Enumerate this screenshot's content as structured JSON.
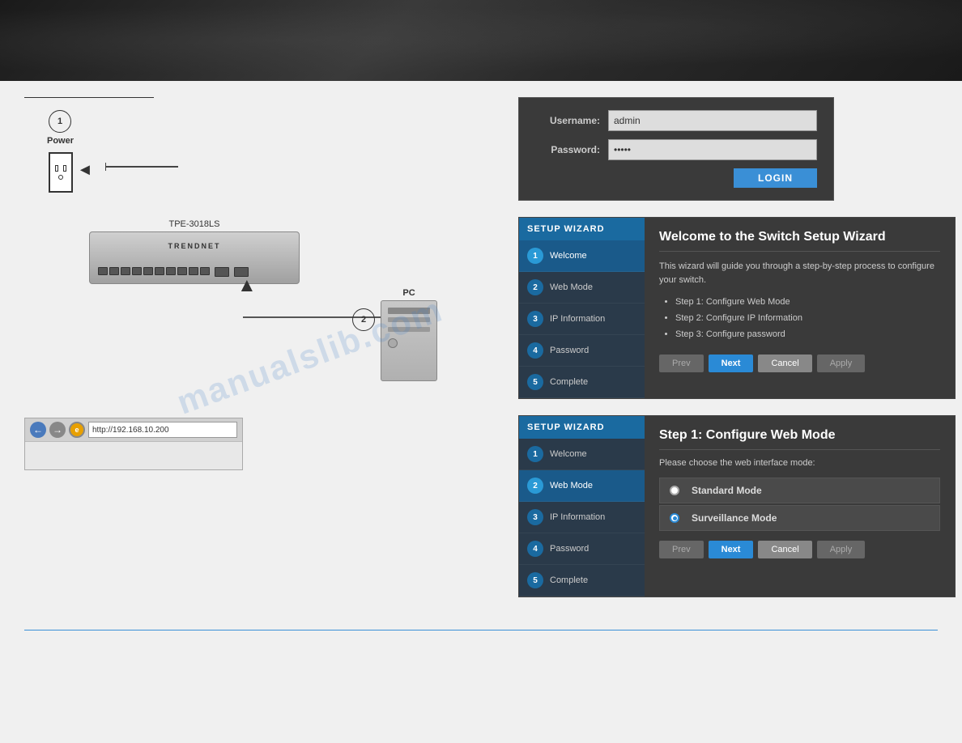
{
  "header": {
    "banner_alt": "TRENDnet header banner"
  },
  "hardware": {
    "step1_number": "1",
    "power_label": "Power",
    "device_model": "TPE-3018LS",
    "brand_text": "TRENDNET",
    "step2_number": "2",
    "pc_label": "PC",
    "browser_url": "http://192.168.10.200"
  },
  "login": {
    "username_label": "Username:",
    "username_value": "admin",
    "password_label": "Password:",
    "password_value": "•••••",
    "login_button": "LOGIN"
  },
  "wizard1": {
    "sidebar_header": "SETUP WIZARD",
    "title": "Welcome to the Switch Setup Wizard",
    "description": "This wizard will guide you through a step-by-step process to configure your switch.",
    "steps": [
      "Step 1: Configure Web Mode",
      "Step 2: Configure IP Information",
      "Step 3: Configure password"
    ],
    "btn_prev": "Prev",
    "btn_next": "Next",
    "btn_cancel": "Cancel",
    "btn_apply": "Apply",
    "nav": [
      {
        "number": "1",
        "label": "Welcome",
        "active": true
      },
      {
        "number": "2",
        "label": "Web Mode"
      },
      {
        "number": "3",
        "label": "IP Information"
      },
      {
        "number": "4",
        "label": "Password"
      },
      {
        "number": "5",
        "label": "Complete"
      }
    ]
  },
  "wizard2": {
    "sidebar_header": "SETUP WIZARD",
    "title": "Step 1: Configure Web Mode",
    "description": "Please choose the web interface mode:",
    "options": [
      {
        "label": "Standard Mode",
        "selected": false
      },
      {
        "label": "Surveillance Mode",
        "selected": true
      }
    ],
    "btn_prev": "Prev",
    "btn_next": "Next",
    "btn_cancel": "Cancel",
    "btn_apply": "Apply",
    "nav": [
      {
        "number": "1",
        "label": "Welcome"
      },
      {
        "number": "2",
        "label": "Web Mode",
        "active": true
      },
      {
        "number": "3",
        "label": "IP Information"
      },
      {
        "number": "4",
        "label": "Password"
      },
      {
        "number": "5",
        "label": "Complete"
      }
    ]
  },
  "watermark": {
    "text": "manualslib.com"
  }
}
